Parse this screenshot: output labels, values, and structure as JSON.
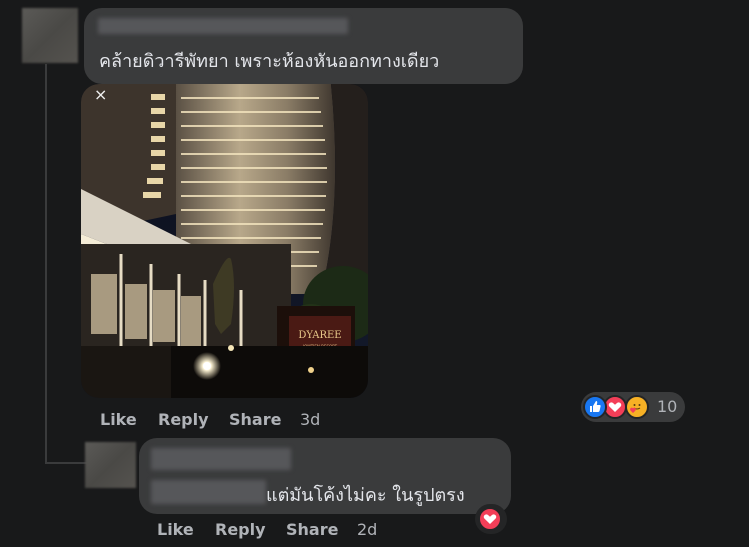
{
  "comment1": {
    "text": "คล้ายดิวารีพัทยา เพราะห้องหันออกทางเดียว",
    "photo": {
      "close_glyph": "×",
      "sign_text": "DYAREE",
      "sign_subtext": "JOMTIEN RESORT"
    },
    "actions": {
      "like": "Like",
      "reply": "Reply",
      "share": "Share",
      "time": "3d"
    },
    "reactions": {
      "icons": [
        "like-icon",
        "love-icon",
        "care-icon"
      ],
      "count": "10"
    }
  },
  "reply1": {
    "text": "แต่มันโค้งไม่คะ ในรูปตรง",
    "actions": {
      "like": "Like",
      "reply": "Reply",
      "share": "Share",
      "time": "2d"
    },
    "reactions": {
      "icons": [
        "love-icon"
      ]
    }
  },
  "colors": {
    "background": "#18191a",
    "bubble": "#3a3b3c",
    "text": "#e4e6eb",
    "secondary_text": "#b0b3b8",
    "like_blue": "#1877f2",
    "love_red": "#f33e58",
    "care_yellow": "#f7b125"
  }
}
